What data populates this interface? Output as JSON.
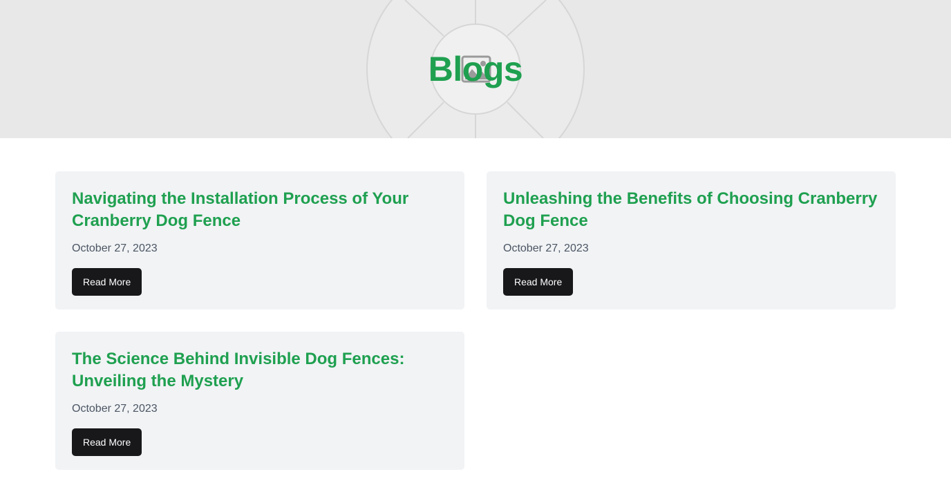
{
  "header": {
    "title": "Blogs",
    "background_color": "#e8e8e8",
    "title_color": "#1fa050"
  },
  "posts": [
    {
      "title": "Navigating the Installation Process of Your Cranberry Dog Fence",
      "date": "October 27, 2023",
      "button_label": "Read More"
    },
    {
      "title": "Unleashing the Benefits of Choosing Cranberry Dog Fence",
      "date": "October 27, 2023",
      "button_label": "Read More"
    },
    {
      "title": "The Science Behind Invisible Dog Fences: Unveiling the Mystery",
      "date": "October 27, 2023",
      "button_label": "Read More"
    }
  ],
  "colors": {
    "accent": "#1fa050",
    "card_bg": "#f1f3f5",
    "button_bg": "#18181b",
    "date_text": "#4b5563"
  },
  "icons": {
    "hero_placeholder": "image-placeholder-icon"
  }
}
